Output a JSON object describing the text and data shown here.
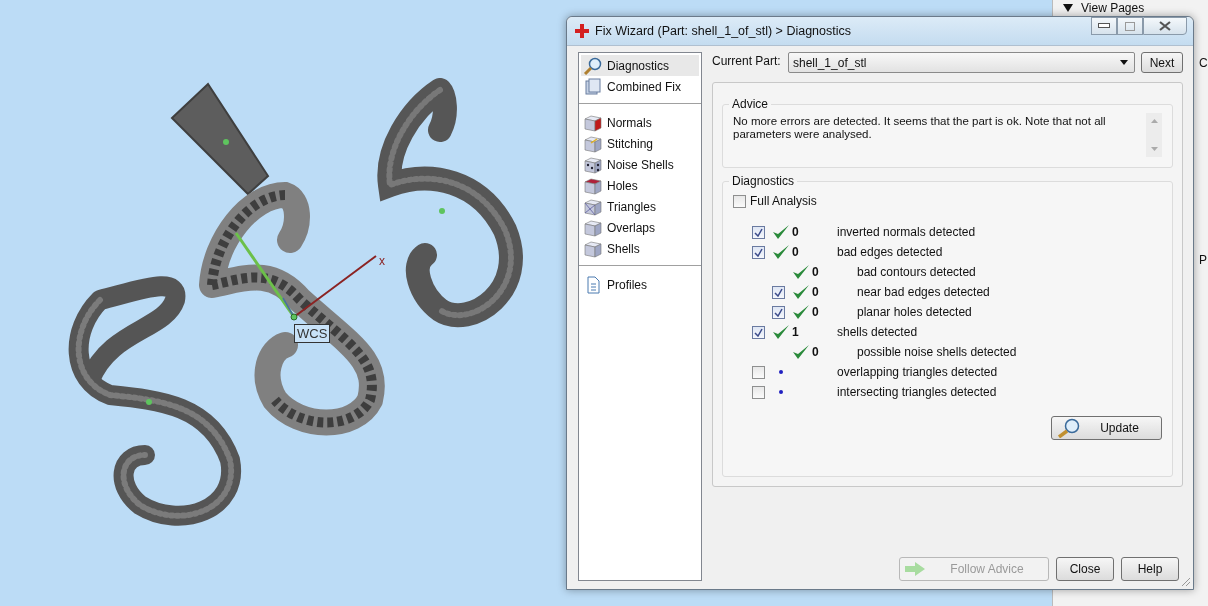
{
  "viewport": {
    "wcs_label": "WCS",
    "axis_label": "x"
  },
  "side_panel": {
    "header": "View Pages",
    "fragments": [
      "C",
      "P"
    ]
  },
  "window": {
    "title": "Fix Wizard (Part: shell_1_of_stl) > Diagnostics"
  },
  "nav": {
    "groups": [
      [
        {
          "label": "Diagnostics",
          "kind": "search",
          "selected": true
        },
        {
          "label": "Combined Fix",
          "kind": "stack",
          "selected": false
        }
      ],
      [
        {
          "label": "Normals",
          "kind": "normals",
          "selected": false
        },
        {
          "label": "Stitching",
          "kind": "stitching",
          "selected": false
        },
        {
          "label": "Noise Shells",
          "kind": "noise",
          "selected": false
        },
        {
          "label": "Holes",
          "kind": "holes",
          "selected": false
        },
        {
          "label": "Triangles",
          "kind": "triangles",
          "selected": false
        },
        {
          "label": "Overlaps",
          "kind": "overlaps",
          "selected": false
        },
        {
          "label": "Shells",
          "kind": "shells",
          "selected": false
        }
      ],
      [
        {
          "label": "Profiles",
          "kind": "document",
          "selected": false
        }
      ]
    ]
  },
  "current_part": {
    "label": "Current Part:",
    "value": "shell_1_of_stl",
    "next": "Next"
  },
  "advice": {
    "title": "Advice",
    "text": "No more errors are detected. It seems that the part is ok. Note that not all parameters were analysed."
  },
  "diagnostics": {
    "title": "Diagnostics",
    "full_analysis": {
      "label": "Full Analysis",
      "checked": false
    },
    "rows": [
      {
        "has_checkbox": true,
        "checked": true,
        "passed": true,
        "count": "0",
        "label": "inverted normals detected"
      },
      {
        "has_checkbox": true,
        "checked": true,
        "passed": true,
        "count": "0",
        "label": "bad edges detected",
        "children": [
          {
            "has_checkbox": false,
            "passed": true,
            "count": "0",
            "label": "bad contours detected"
          },
          {
            "has_checkbox": true,
            "checked": true,
            "passed": true,
            "count": "0",
            "label": "near bad edges detected"
          },
          {
            "has_checkbox": true,
            "checked": true,
            "passed": true,
            "count": "0",
            "label": "planar holes detected"
          }
        ]
      },
      {
        "has_checkbox": true,
        "checked": true,
        "passed": true,
        "count": "1",
        "label": "shells detected",
        "children": [
          {
            "has_checkbox": false,
            "passed": true,
            "count": "0",
            "label": "possible noise shells detected"
          }
        ]
      },
      {
        "has_checkbox": true,
        "checked": false,
        "passed": false,
        "label": "overlapping triangles detected"
      },
      {
        "has_checkbox": true,
        "checked": false,
        "passed": false,
        "label": "intersecting triangles detected"
      }
    ],
    "update": "Update"
  },
  "footer_buttons": [
    {
      "label": "Follow Advice",
      "kind": "advice",
      "disabled": true
    },
    {
      "label": "Close",
      "kind": "plain",
      "disabled": false
    },
    {
      "label": "Help",
      "kind": "plain",
      "disabled": false
    }
  ]
}
